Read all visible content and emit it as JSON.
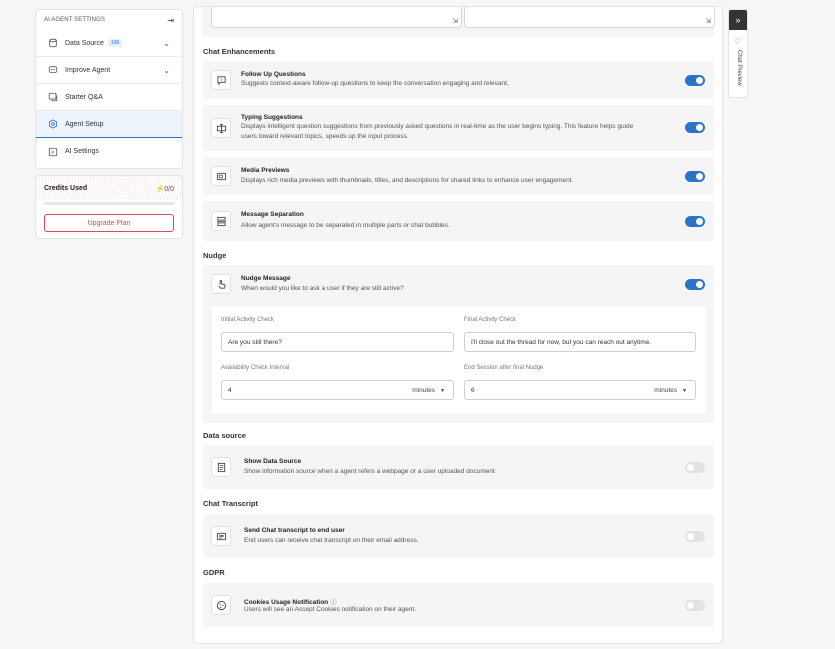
{
  "sidebar": {
    "header": "AI AGENT SETTINGS",
    "items": [
      {
        "label": "Data Source",
        "badge": "100",
        "chevron": true,
        "icon": "database-icon"
      },
      {
        "label": "Improve Agent",
        "chevron": true,
        "icon": "improve-icon"
      },
      {
        "label": "Starter Q&A",
        "icon": "qa-icon"
      },
      {
        "label": "Agent Setup",
        "active": true,
        "icon": "settings-icon"
      },
      {
        "label": "AI Settings",
        "icon": "ai-icon"
      }
    ]
  },
  "credits": {
    "title": "Credits Used",
    "value": "0/0",
    "progress": 0,
    "upgrade_label": "Upgrade Plan"
  },
  "sections": {
    "chat_enhancements": "Chat Enhancements",
    "nudge": "Nudge",
    "data_source": "Data source",
    "chat_transcript": "Chat Transcript",
    "gdpr": "GDPR"
  },
  "features": {
    "follow_up": {
      "title": "Follow Up Questions",
      "desc": "Suggests context-aware follow-up questions to keep the conversation engaging and relevant.",
      "enabled": true
    },
    "typing": {
      "title": "Typing Suggestions",
      "desc1": "Displays intelligent question suggestions from previously asked questions in real-time as the user begins typing. This feature helps guide",
      "desc2": "users toward relevant topics, speeds up the input process.",
      "enabled": true
    },
    "media": {
      "title": "Media Previews",
      "desc": "Displays rich media previews with thumbnails, titles, and descriptions for shared links to enhance user engagement.",
      "enabled": true
    },
    "separation": {
      "title": "Message Separation",
      "desc": "Allow agent's message to be separated in multiple parts or chat bubbles.",
      "enabled": true
    },
    "nudge": {
      "title": "Nudge Message",
      "desc": "When would you like to ask a user if they are still active?",
      "enabled": true,
      "initial_label": "Initial Activity Check",
      "initial_value": "Are you still there?",
      "final_label": "Final Activity Check",
      "final_value": "I'll close out the thread for now, but you can reach out anytime.",
      "interval_label": "Availability Check Interval",
      "interval_value": "4",
      "interval_unit": "minutes",
      "end_label": "End Session after final Nudge",
      "end_value": "6",
      "end_unit": "minutes"
    },
    "show_source": {
      "title": "Show Data Source",
      "desc": "Show information source when a agent refers a webpage or a user uploaded document",
      "enabled": false
    },
    "transcript": {
      "title": "Send Chat transcript to end user",
      "desc": "End users can receive chat transcript on their email address.",
      "enabled": false
    },
    "cookies": {
      "title": "Cookies Usage Notification",
      "desc": "Users will see an Accept Cookies notification on their agent.",
      "enabled": false
    }
  },
  "preview": {
    "label": "Chat Preview"
  },
  "colors": {
    "accent": "#2b73c8",
    "danger": "#d94a5a"
  }
}
